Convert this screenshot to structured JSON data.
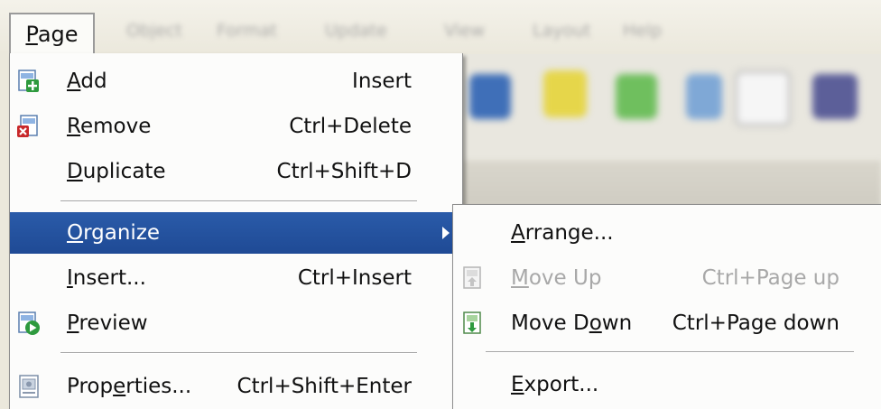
{
  "menubar": {
    "active": "Page",
    "active_accel": "P",
    "active_rest": "age",
    "blurred_items": [
      "Object",
      "Format",
      "Update",
      "View",
      "Layout",
      "Help"
    ]
  },
  "main_menu": {
    "items": [
      {
        "accel": "A",
        "rest": "dd",
        "shortcut": "Insert",
        "icon": "add-page-icon"
      },
      {
        "accel": "R",
        "rest": "emove",
        "shortcut": "Ctrl+Delete",
        "icon": "remove-page-icon"
      },
      {
        "accel": "D",
        "rest": "uplicate",
        "shortcut": "Ctrl+Shift+D",
        "icon": ""
      },
      {
        "accel": "O",
        "rest": "rganize",
        "shortcut": "",
        "icon": "",
        "highlighted": true,
        "has_submenu": true
      },
      {
        "accel": "I",
        "rest": "nsert...",
        "shortcut": "Ctrl+Insert",
        "icon": ""
      },
      {
        "accel": "P",
        "rest": "review",
        "shortcut": "",
        "icon": "preview-icon"
      },
      {
        "pre": "Prop",
        "accel": "e",
        "rest": "rties...",
        "shortcut": "Ctrl+Shift+Enter",
        "icon": "properties-icon"
      }
    ]
  },
  "sub_menu": {
    "items": [
      {
        "accel": "A",
        "rest": "rrange...",
        "shortcut": "",
        "icon": ""
      },
      {
        "accel": "M",
        "rest": "ove Up",
        "shortcut": "Ctrl+Page up",
        "icon": "move-up-icon",
        "disabled": true
      },
      {
        "pre": "Move D",
        "accel": "o",
        "rest": "wn",
        "shortcut": "Ctrl+Page down",
        "icon": "move-down-icon"
      },
      {
        "accel": "E",
        "rest": "xport...",
        "shortcut": "",
        "icon": ""
      }
    ]
  },
  "colors": {
    "highlight": "#2153a3",
    "menu_bg": "#fcfcfb",
    "disabled_text": "#a8a8a8"
  }
}
